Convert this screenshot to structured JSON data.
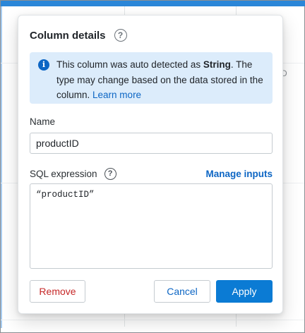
{
  "colors": {
    "accent": "#0d66c4",
    "primary_button": "#0b7bd4",
    "danger": "#c62828",
    "info_bg": "#dcecfb",
    "top_bar": "#2a86d8"
  },
  "background": {
    "peek_text": "D"
  },
  "dialog": {
    "title": "Column details",
    "help_icon": "?",
    "info": {
      "icon": "i",
      "text_before": "This column was auto detected as ",
      "type": "String",
      "text_after": ". The type may change based on the data stored in the column. ",
      "link": "Learn more"
    },
    "name": {
      "label": "Name",
      "value": "productID"
    },
    "sql": {
      "label": "SQL expression",
      "help_icon": "?",
      "manage_inputs": "Manage inputs",
      "expression": "“productID”"
    },
    "buttons": {
      "remove": "Remove",
      "cancel": "Cancel",
      "apply": "Apply"
    }
  }
}
